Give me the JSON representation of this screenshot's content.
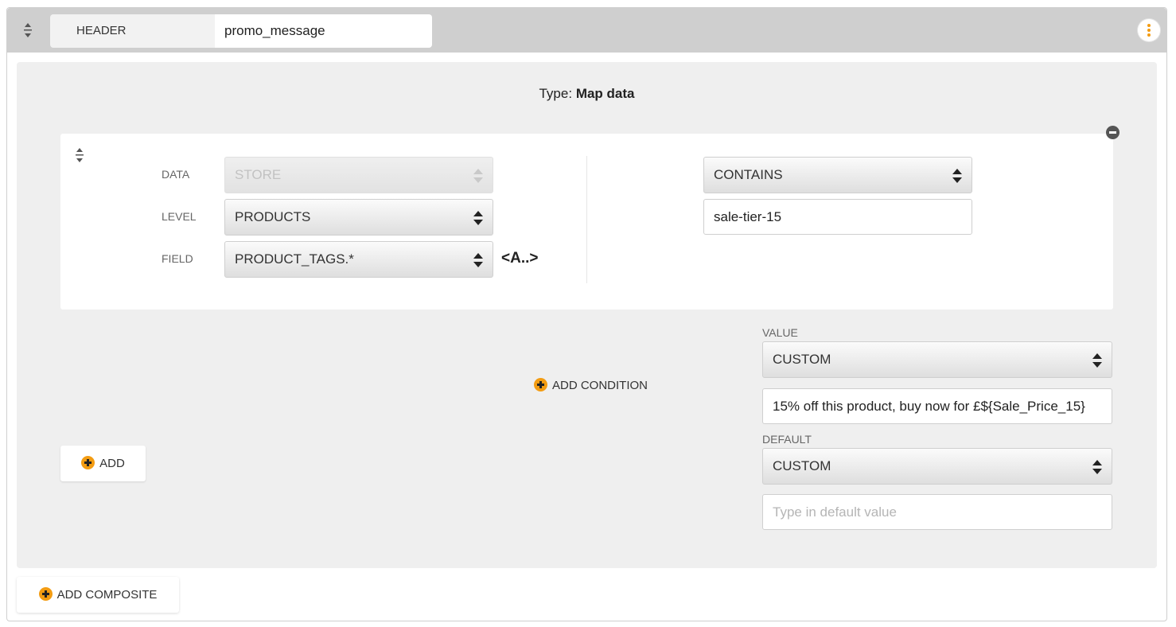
{
  "header": {
    "tab_label": "HEADER",
    "name_value": "promo_message"
  },
  "panel": {
    "type_prefix": "Type:",
    "type_value": "Map data"
  },
  "condition": {
    "data_label": "DATA",
    "data_value": "STORE",
    "level_label": "LEVEL",
    "level_value": "PRODUCTS",
    "field_label": "FIELD",
    "field_value": "PRODUCT_TAGS.*",
    "field_tag": "<A..>",
    "operator_value": "CONTAINS",
    "match_value": "sale-tier-15"
  },
  "actions": {
    "add_condition": "ADD CONDITION",
    "add": "ADD",
    "add_composite": "ADD COMPOSITE"
  },
  "value_section": {
    "label": "VALUE",
    "type_value": "CUSTOM",
    "text": "15% off this product, buy now for £${Sale_Price_15}"
  },
  "default_section": {
    "label": "DEFAULT",
    "type_value": "CUSTOM",
    "placeholder": "Type in default value"
  },
  "colors": {
    "accent": "#f39c12",
    "topbar": "#cfcfcf",
    "panel": "#efefef"
  }
}
